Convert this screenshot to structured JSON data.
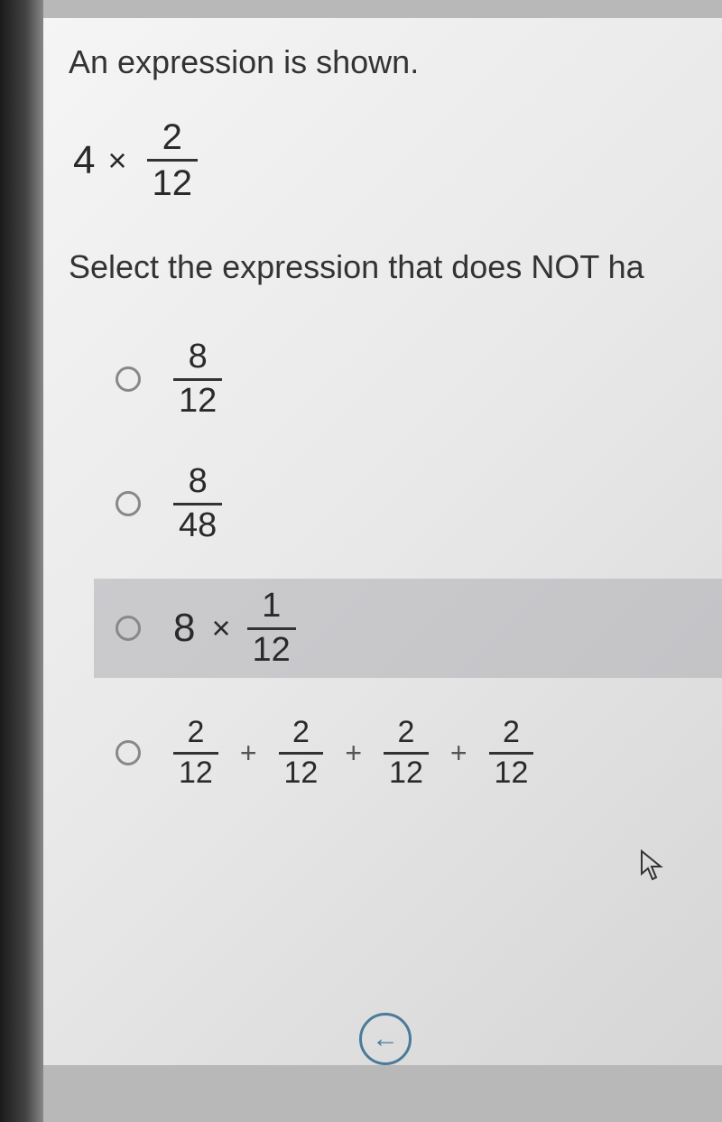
{
  "question": {
    "prompt": "An expression is shown.",
    "expression": {
      "whole": "4",
      "operator": "×",
      "fraction": {
        "numerator": "2",
        "denominator": "12"
      }
    },
    "instruction": "Select the expression that does NOT ha"
  },
  "options": [
    {
      "type": "fraction",
      "fraction": {
        "numerator": "8",
        "denominator": "12"
      },
      "highlighted": false
    },
    {
      "type": "fraction",
      "fraction": {
        "numerator": "8",
        "denominator": "48"
      },
      "highlighted": false
    },
    {
      "type": "mult",
      "whole": "8",
      "operator": "×",
      "fraction": {
        "numerator": "1",
        "denominator": "12"
      },
      "highlighted": true
    },
    {
      "type": "sum",
      "terms": [
        {
          "numerator": "2",
          "denominator": "12"
        },
        {
          "numerator": "2",
          "denominator": "12"
        },
        {
          "numerator": "2",
          "denominator": "12"
        },
        {
          "numerator": "2",
          "denominator": "12"
        }
      ],
      "operator": "+",
      "highlighted": false
    }
  ],
  "nav": {
    "back_arrow": "←"
  },
  "cursor_glyph": "⬀"
}
